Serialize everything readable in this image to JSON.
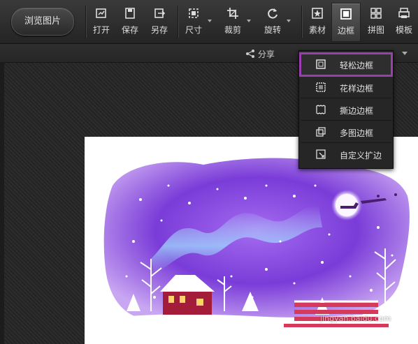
{
  "toolbar": {
    "browse_label": "浏览图片",
    "tools": [
      {
        "label": "打开",
        "icon": "open-icon"
      },
      {
        "label": "保存",
        "icon": "save-icon"
      },
      {
        "label": "另存",
        "icon": "save-as-icon"
      },
      {
        "label": "尺寸",
        "icon": "resize-icon"
      },
      {
        "label": "裁剪",
        "icon": "crop-icon"
      },
      {
        "label": "旋转",
        "icon": "rotate-icon"
      },
      {
        "label": "素材",
        "icon": "material-icon"
      },
      {
        "label": "边框",
        "icon": "border-icon"
      },
      {
        "label": "拼图",
        "icon": "collage-icon"
      },
      {
        "label": "模板",
        "icon": "template-icon"
      }
    ]
  },
  "subbar": {
    "share_label": "分享"
  },
  "border_menu": {
    "items": [
      {
        "label": "轻松边框",
        "icon": "simple-border-icon",
        "selected": true
      },
      {
        "label": "花样边框",
        "icon": "pattern-border-icon"
      },
      {
        "label": "撕边边框",
        "icon": "torn-border-icon"
      },
      {
        "label": "多图边框",
        "icon": "multi-image-border-icon"
      },
      {
        "label": "自定义扩边",
        "icon": "custom-expand-icon"
      }
    ]
  },
  "watermark": "jingyan.baidu.com",
  "colors": {
    "highlight": "#9b3fb0",
    "toolbar_bg": "#2e2e2e",
    "night_sky": "#7a3cd8"
  }
}
